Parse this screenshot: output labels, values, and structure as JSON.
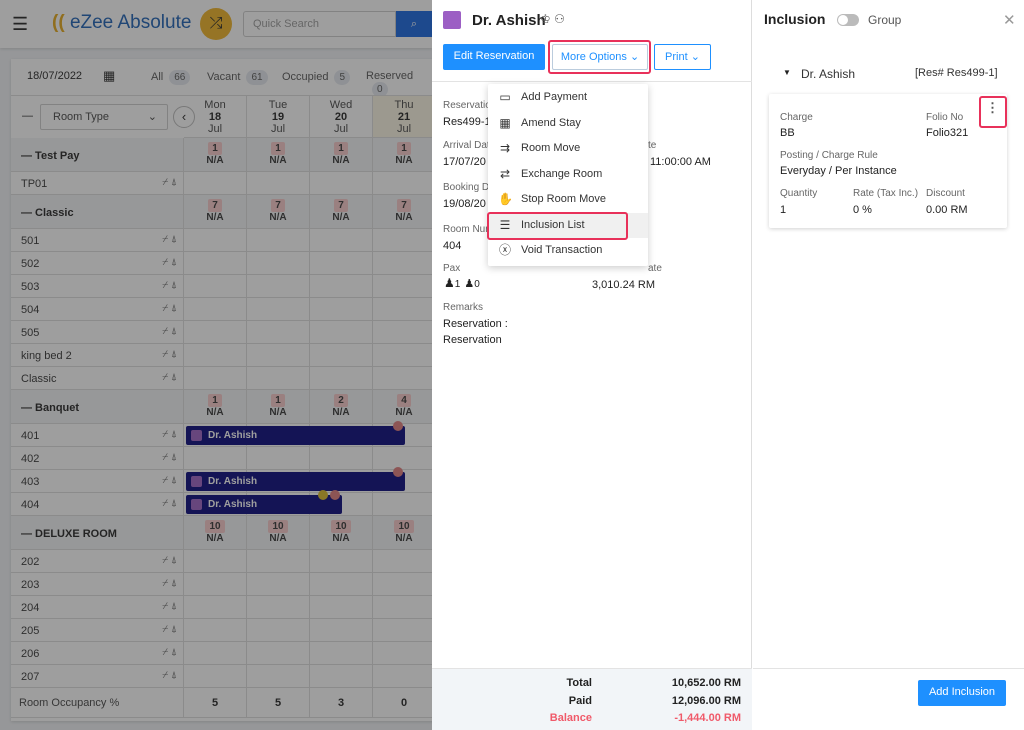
{
  "header": {
    "app_name": "eZee Absolute",
    "search_placeholder": "Quick Search"
  },
  "toolbar": {
    "date": "18/07/2022",
    "counts": [
      {
        "label": "All",
        "value": "66"
      },
      {
        "label": "Vacant",
        "value": "61"
      },
      {
        "label": "Occupied",
        "value": "5"
      },
      {
        "label": "Reserved",
        "value": "0"
      }
    ]
  },
  "grid": {
    "filter": "Room Type",
    "days": [
      {
        "dow": "Mon",
        "day": "18",
        "mon": "Jul"
      },
      {
        "dow": "Tue",
        "day": "19",
        "mon": "Jul"
      },
      {
        "dow": "Wed",
        "day": "20",
        "mon": "Jul"
      },
      {
        "dow": "Thu",
        "day": "21",
        "mon": "Jul"
      }
    ],
    "sections": [
      {
        "name": "Test Pay",
        "avail": [
          "1",
          "1",
          "1",
          "1"
        ],
        "na": "N/A",
        "rooms": [
          "TP01"
        ]
      },
      {
        "name": "Classic",
        "avail": [
          "7",
          "7",
          "7",
          "7"
        ],
        "na": "N/A",
        "rooms": [
          "501",
          "502",
          "503",
          "504",
          "505",
          "king bed 2",
          "Classic"
        ]
      },
      {
        "name": "Banquet",
        "avail": [
          "1",
          "1",
          "2",
          "4"
        ],
        "na": "N/A",
        "rooms": [
          "401",
          "402",
          "403",
          "404"
        ]
      },
      {
        "name": "DELUXE ROOM",
        "avail": [
          "10",
          "10",
          "10",
          "10"
        ],
        "na": "N/A",
        "rooms": [
          "202",
          "203",
          "204",
          "205",
          "206",
          "207"
        ]
      }
    ],
    "reservations": [
      {
        "room": "401",
        "guest": "Dr. Ashish"
      },
      {
        "room": "403",
        "guest": "Dr. Ashish"
      },
      {
        "room": "404",
        "guest": "Dr. Ashish"
      }
    ],
    "occupancy_label": "Room Occupancy %",
    "occupancy": [
      "5",
      "5",
      "3",
      "0"
    ]
  },
  "reservation": {
    "guest": "Dr. Ashish",
    "edit_label": "Edit Reservation",
    "more_label": "More Options",
    "print_label": "Print",
    "fields": [
      {
        "label": "Reservatio",
        "value": "Res499-1"
      },
      {
        "label": "Arrival Dat",
        "value": "17/07/20"
      },
      {
        "label": "Booking Da",
        "value": "19/08/20"
      },
      {
        "label": "Room Nur",
        "value": "404"
      },
      {
        "label": "Pax",
        "value": ""
      }
    ],
    "right_fields": [
      {
        "label": "te",
        "value": "11:00:00 AM"
      },
      {
        "label": "ate",
        "value": "3,010.24 RM"
      }
    ],
    "pax_adults": "1",
    "pax_children": "0",
    "remarks_label": "Remarks",
    "remarks": [
      "Reservation :",
      "Reservation"
    ],
    "menu": [
      {
        "label": "Add Payment",
        "icon": "wallet-icon"
      },
      {
        "label": "Amend Stay",
        "icon": "calendar-edit-icon"
      },
      {
        "label": "Room Move",
        "icon": "room-move-icon"
      },
      {
        "label": "Exchange Room",
        "icon": "exchange-room-icon"
      },
      {
        "label": "Stop Room Move",
        "icon": "hand-stop-icon"
      },
      {
        "label": "Inclusion List",
        "icon": "inclusion-icon"
      },
      {
        "label": "Void Transaction",
        "icon": "void-icon"
      }
    ],
    "totals": {
      "total_label": "Total",
      "total": "10,652.00 RM",
      "paid_label": "Paid",
      "paid": "12,096.00 RM",
      "balance_label": "Balance",
      "balance": "-1,444.00 RM"
    }
  },
  "inclusion": {
    "title": "Inclusion",
    "group_label": "Group",
    "group_on": false,
    "guest": "Dr. Ashish",
    "res_no": "[Res# Res499-1]",
    "charge_label": "Charge",
    "charge": "BB",
    "folio_label": "Folio No",
    "folio": "Folio321",
    "rule_label": "Posting / Charge Rule",
    "rule": "Everyday / Per Instance",
    "qty_label": "Quantity",
    "qty": "1",
    "rate_label": "Rate (Tax Inc.)",
    "rate": "0 %",
    "disc_label": "Discount",
    "disc": "0.00 RM",
    "add_label": "Add Inclusion"
  },
  "colors": {
    "accent": "#1e90ff",
    "highlight": "#e8315a",
    "booking": "#05057a",
    "balance": "#f05a6a"
  }
}
